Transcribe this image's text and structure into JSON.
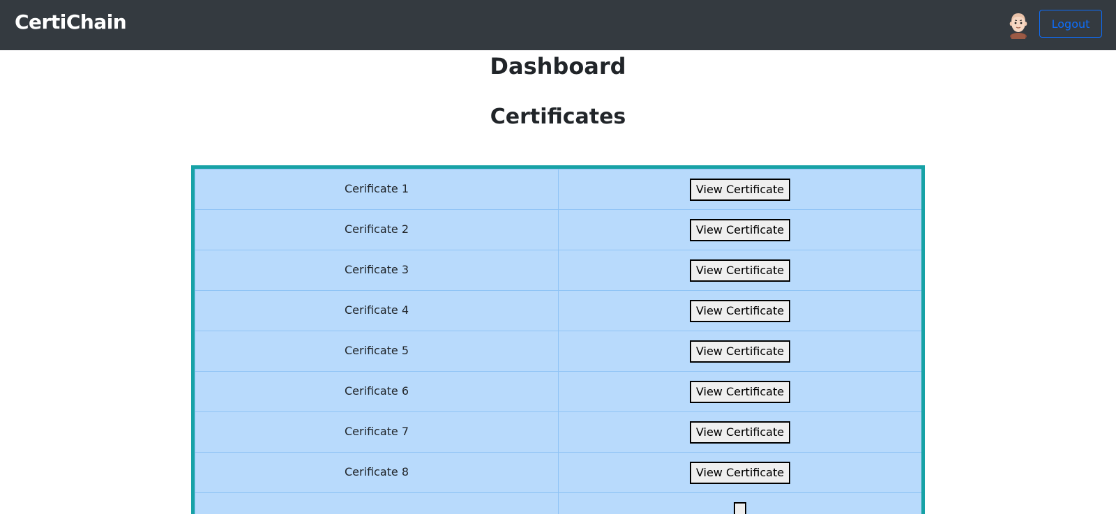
{
  "navbar": {
    "brand": "CertiChain",
    "logout_label": "Logout",
    "avatar_icon": "user-avatar-icon"
  },
  "main": {
    "title": "Dashboard",
    "subtitle": "Certificates"
  },
  "certificates": {
    "rows": [
      {
        "name": "Cerificate 1",
        "action": "View Certificate"
      },
      {
        "name": "Cerificate 2",
        "action": "View Certificate"
      },
      {
        "name": "Cerificate 3",
        "action": "View Certificate"
      },
      {
        "name": "Cerificate 4",
        "action": "View Certificate"
      },
      {
        "name": "Cerificate 5",
        "action": "View Certificate"
      },
      {
        "name": "Cerificate 6",
        "action": "View Certificate"
      },
      {
        "name": "Cerificate 7",
        "action": "View Certificate"
      },
      {
        "name": "Cerificate 8",
        "action": "View Certificate"
      },
      {
        "name": "",
        "action": ""
      }
    ]
  },
  "colors": {
    "navbar_bg": "#343a40",
    "accent": "#0d6efd",
    "table_border": "#17a2a6",
    "row_bg": "#b8dafc"
  }
}
